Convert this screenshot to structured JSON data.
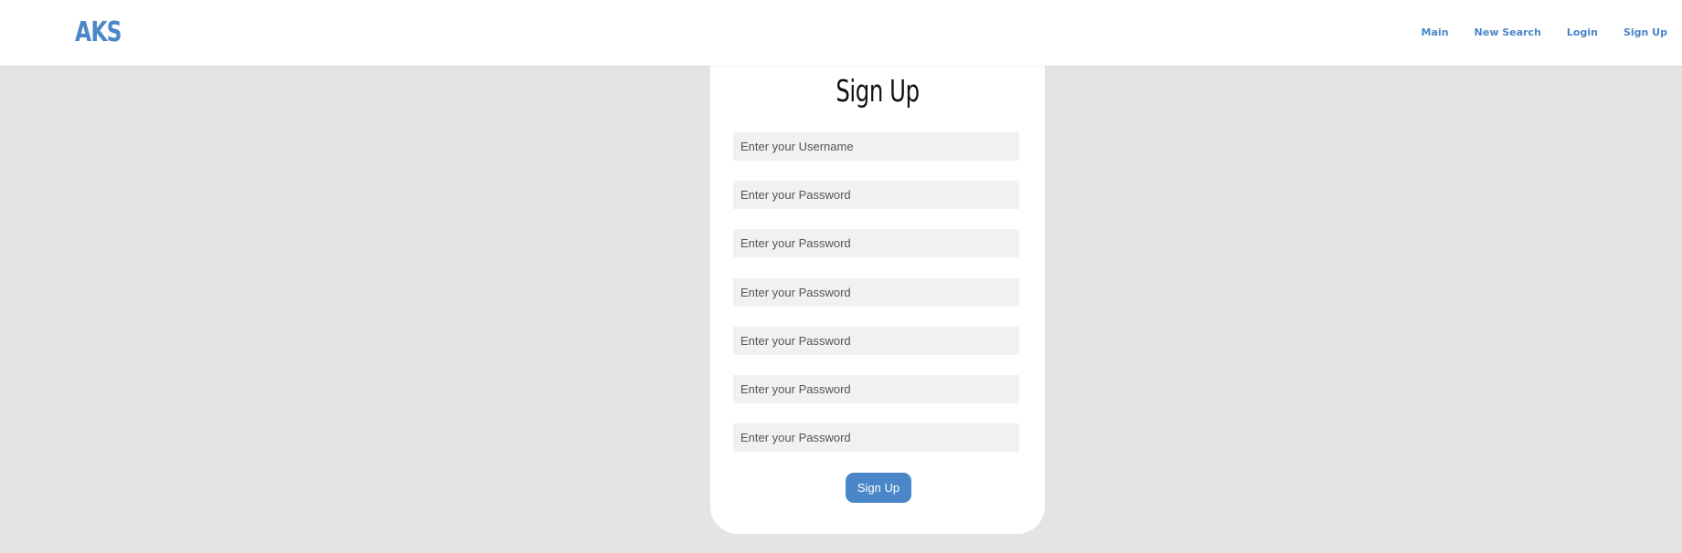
{
  "colors": {
    "accent": "#4a86c8",
    "background": "#e4e4e4",
    "card": "#ffffff",
    "field": "#f1f1f1"
  },
  "header": {
    "logo": "AKS",
    "nav": [
      {
        "label": "Main"
      },
      {
        "label": "New Search"
      },
      {
        "label": "Login"
      },
      {
        "label": "Sign Up"
      }
    ]
  },
  "form": {
    "title": "Sign Up",
    "fields": [
      {
        "placeholder": "Enter your Username",
        "value": ""
      },
      {
        "placeholder": "Enter your Password",
        "value": ""
      },
      {
        "placeholder": "Enter your Password",
        "value": ""
      },
      {
        "placeholder": "Enter your Password",
        "value": ""
      },
      {
        "placeholder": "Enter your Password",
        "value": ""
      },
      {
        "placeholder": "Enter your Password",
        "value": ""
      },
      {
        "placeholder": "Enter your Password",
        "value": ""
      }
    ],
    "submit_label": "Sign Up"
  }
}
